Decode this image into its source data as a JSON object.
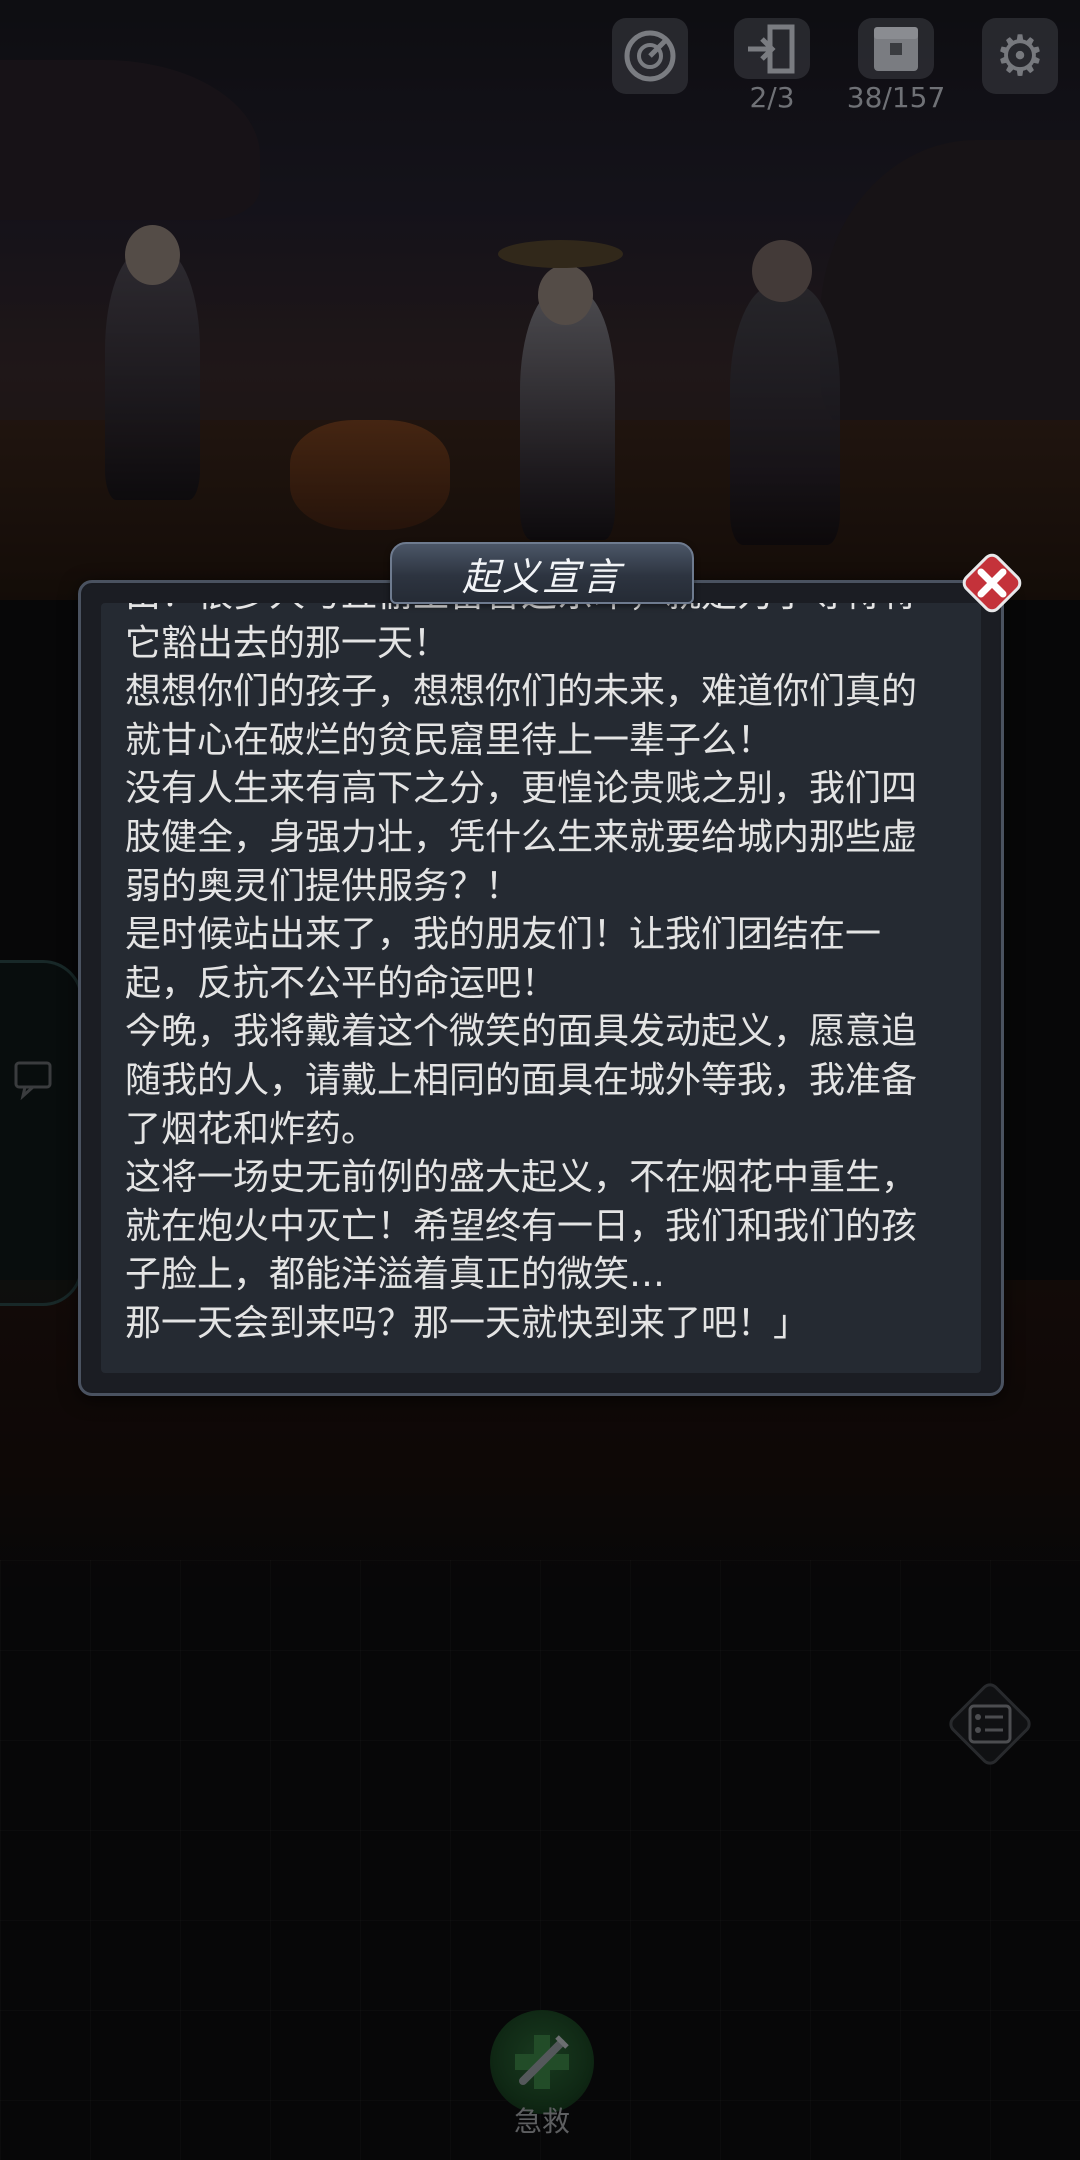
{
  "hud": {
    "exit_count": "2/3",
    "storage_count": "38/157"
  },
  "dialog": {
    "title": "起义宣言",
    "paragraphs": [
      "由！很多人与丘偷土留音这东印，就是为了等待将它豁出去的那一天！",
      "想想你们的孩子，想想你们的未来，难道你们真的就甘心在破烂的贫民窟里待上一辈子么！",
      "没有人生来有高下之分，更惶论贵贱之别，我们四肢健全，身强力壮，凭什么生来就要给城内那些虚弱的奥灵们提供服务？！",
      "是时候站出来了，我的朋友们！让我们团结在一起，反抗不公平的命运吧！",
      "今晚，我将戴着这个微笑的面具发动起义，愿意追随我的人，请戴上相同的面具在城外等我，我准备了烟花和炸药。",
      "这将一场史无前例的盛大起义，不在烟花中重生，就在炮火中灭亡！希望终有一日，我们和我们的孩子脸上，都能洋溢着真正的微笑…",
      "那一天会到来吗？那一天就快到来了吧！」"
    ]
  },
  "bottom": {
    "rescue_label": "急救"
  },
  "icons": {
    "radar": "radar-icon",
    "exit": "exit-door-icon",
    "storage": "storage-box-icon",
    "settings": "gear-icon",
    "close": "close-icon",
    "chat": "chat-icon",
    "quest": "quest-list-icon",
    "rescue": "syringe-icon"
  },
  "colors": {
    "close_red": "#c4323a",
    "rescue_green": "#2e6a3a",
    "dialog_bg": "#252a32"
  }
}
